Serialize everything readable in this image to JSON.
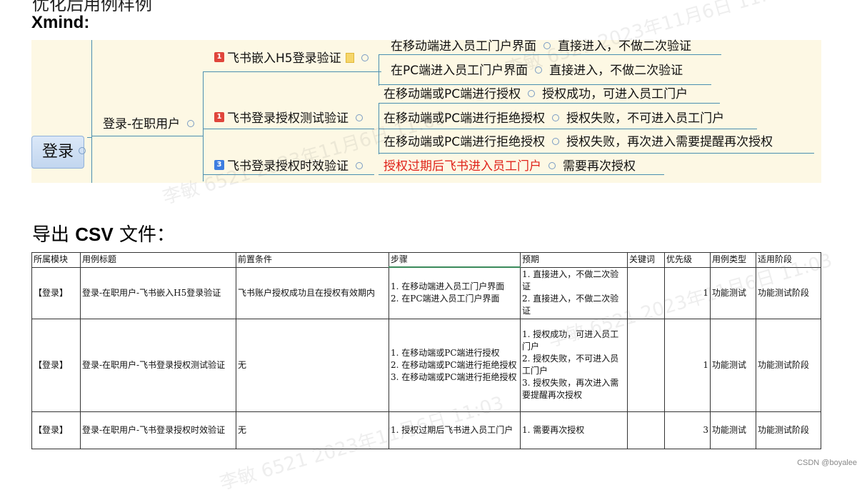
{
  "top_cut_text": "优化后用例样例",
  "xmind_heading": "Xmind:",
  "mindmap": {
    "root": "登录",
    "branch": "登录-在职用户",
    "topics": [
      {
        "badge": "1",
        "label": "飞书嵌入H5登录验证"
      },
      {
        "badge": "1",
        "label": "飞书登录授权测试验证"
      },
      {
        "badge": "3",
        "label": "飞书登录授权时效验证"
      }
    ],
    "rows": [
      {
        "step": "在移动端进入员工门户界面",
        "result": "直接进入，不做二次验证"
      },
      {
        "step": "在PC端进入员工门户界面",
        "result": "直接进入，不做二次验证"
      },
      {
        "step": "在移动端或PC端进行授权",
        "result": "授权成功，可进入员工门户"
      },
      {
        "step": "在移动端或PC端进行拒绝授权",
        "result": "授权失败，不可进入员工门户"
      },
      {
        "step": "在移动端或PC端进行拒绝授权",
        "result": "授权失败，再次进入需要提醒再次授权"
      },
      {
        "step": "授权过期后飞书进入员工门户",
        "result": "需要再次授权"
      }
    ]
  },
  "export_heading": {
    "prefix": "导出",
    "bold": "CSV",
    "suffix": "文件："
  },
  "table": {
    "headers": [
      "所属模块",
      "用例标题",
      "前置条件",
      "步骤",
      "预期",
      "关键词",
      "优先级",
      "用例类型",
      "适用阶段"
    ],
    "rows": [
      {
        "module": "【登录】",
        "title": "登录-在职用户-飞书嵌入H5登录验证",
        "precondition": "飞书账户授权成功且在授权有效期内",
        "steps": [
          "1.  在移动端进入员工门户界面",
          "2.  在PC端进入员工门户界面"
        ],
        "expected": [
          "1.  直接进入，不做二次验证",
          "2.  直接进入，不做二次验证"
        ],
        "keyword": "",
        "priority": "1",
        "type": "功能测试",
        "stage": "功能测试阶段"
      },
      {
        "module": "【登录】",
        "title": "登录-在职用户-飞书登录授权测试验证",
        "precondition": "无",
        "steps": [
          "1.  在移动端或PC端进行授权",
          "2.  在移动端或PC端进行拒绝授权",
          "3.  在移动端或PC端进行拒绝授权"
        ],
        "expected": [
          "1.  授权成功，可进入员工门户",
          "2.  授权失败，不可进入员工门户",
          "3.  授权失败，再次进入需要提醒再次授权"
        ],
        "keyword": "",
        "priority": "1",
        "type": "功能测试",
        "stage": "功能测试阶段"
      },
      {
        "module": "【登录】",
        "title": "登录-在职用户-飞书登录授权时效验证",
        "precondition": "无",
        "steps": [
          "1.  授权过期后飞书进入员工门户"
        ],
        "expected": [
          "1.  需要再次授权"
        ],
        "keyword": "",
        "priority": "3",
        "type": "功能测试",
        "stage": "功能测试阶段"
      }
    ]
  },
  "watermark": "李敏 6521 2023年11月6日 11:03",
  "credit": "CSDN @boyalee",
  "colors": {
    "mindmap_bg": "#fdf8e4",
    "link": "#4a8fb0",
    "badge_red": "#e0453b",
    "badge_blue": "#3d7de0",
    "highlight_red": "#e0221a"
  }
}
